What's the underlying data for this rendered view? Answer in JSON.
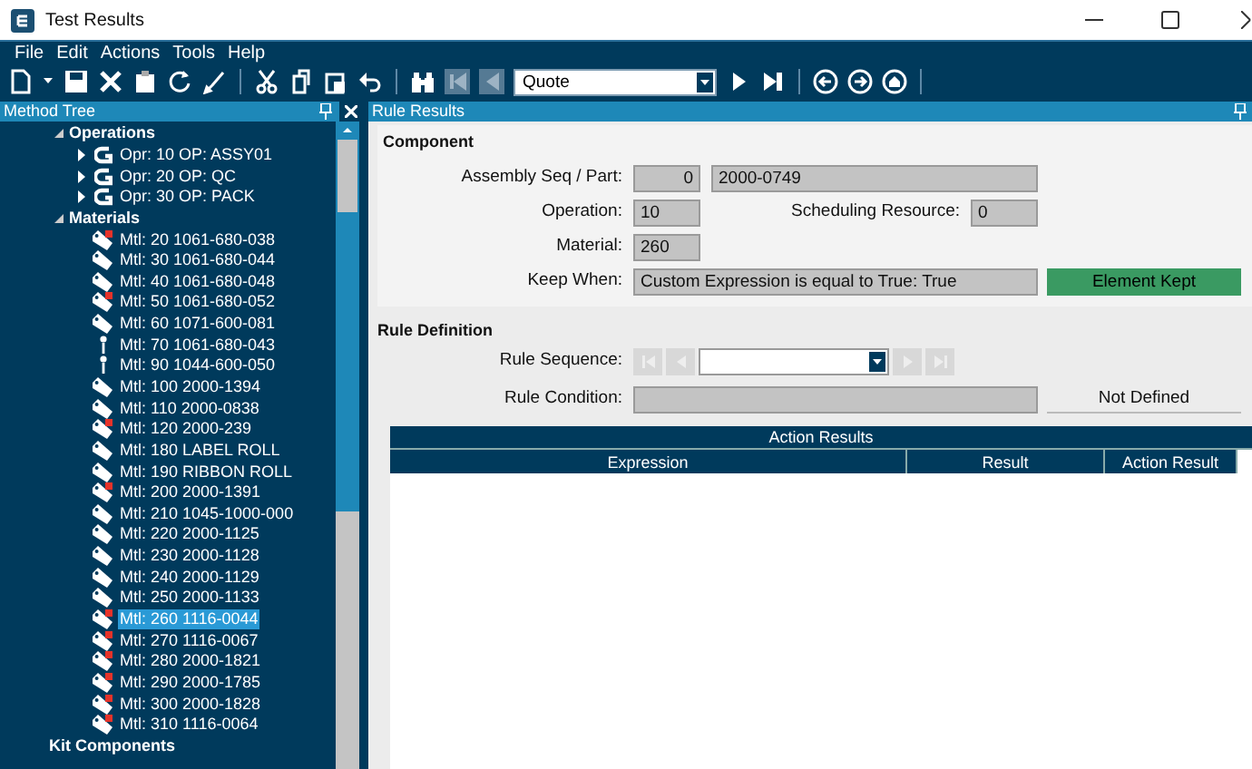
{
  "window": {
    "title": "Test Results"
  },
  "menu": [
    "File",
    "Edit",
    "Actions",
    "Tools",
    "Help"
  ],
  "toolbar": {
    "record_type": {
      "value": "Quote"
    }
  },
  "method_tree": {
    "title": "Method Tree",
    "nodes": [
      {
        "label": "Operations",
        "expanded": true,
        "children": [
          {
            "label": "Opr: 10 OP: ASSY01",
            "kind": "operation",
            "expanded": false,
            "flagged": false,
            "selected": false
          },
          {
            "label": "Opr: 20 OP: QC",
            "kind": "operation",
            "expanded": false,
            "flagged": false,
            "selected": false
          },
          {
            "label": "Opr: 30 OP: PACK",
            "kind": "operation",
            "expanded": false,
            "flagged": false,
            "selected": false
          }
        ]
      },
      {
        "label": "Materials",
        "expanded": true,
        "children": [
          {
            "label": "Mtl: 20 1061-680-038",
            "kind": "tag",
            "flagged": true,
            "selected": false
          },
          {
            "label": "Mtl: 30 1061-680-044",
            "kind": "tag",
            "flagged": false,
            "selected": false
          },
          {
            "label": "Mtl: 40 1061-680-048",
            "kind": "tag",
            "flagged": false,
            "selected": false
          },
          {
            "label": "Mtl: 50 1061-680-052",
            "kind": "tag",
            "flagged": true,
            "selected": false
          },
          {
            "label": "Mtl: 60 1071-600-081",
            "kind": "tag",
            "flagged": false,
            "selected": false
          },
          {
            "label": "Mtl: 70 1061-680-043",
            "kind": "pin",
            "flagged": false,
            "selected": false
          },
          {
            "label": "Mtl: 90 1044-600-050",
            "kind": "pin",
            "flagged": false,
            "selected": false
          },
          {
            "label": "Mtl: 100 2000-1394",
            "kind": "tag",
            "flagged": false,
            "selected": false
          },
          {
            "label": "Mtl: 110 2000-0838",
            "kind": "tag",
            "flagged": false,
            "selected": false
          },
          {
            "label": "Mtl: 120 2000-239",
            "kind": "tag",
            "flagged": true,
            "selected": false
          },
          {
            "label": "Mtl: 180 LABEL ROLL",
            "kind": "tag",
            "flagged": false,
            "selected": false
          },
          {
            "label": "Mtl: 190 RIBBON ROLL",
            "kind": "tag",
            "flagged": false,
            "selected": false
          },
          {
            "label": "Mtl: 200 2000-1391",
            "kind": "tag",
            "flagged": true,
            "selected": false
          },
          {
            "label": "Mtl: 210 1045-1000-000",
            "kind": "tag",
            "flagged": false,
            "selected": false
          },
          {
            "label": "Mtl: 220 2000-1125",
            "kind": "tag",
            "flagged": false,
            "selected": false
          },
          {
            "label": "Mtl: 230 2000-1128",
            "kind": "tag",
            "flagged": false,
            "selected": false
          },
          {
            "label": "Mtl: 240 2000-1129",
            "kind": "tag",
            "flagged": false,
            "selected": false
          },
          {
            "label": "Mtl: 250 2000-1133",
            "kind": "tag",
            "flagged": false,
            "selected": false
          },
          {
            "label": "Mtl: 260 1116-0044",
            "kind": "tag",
            "flagged": true,
            "selected": true
          },
          {
            "label": "Mtl: 270 1116-0067",
            "kind": "tag",
            "flagged": true,
            "selected": false
          },
          {
            "label": "Mtl: 280 2000-1821",
            "kind": "tag",
            "flagged": true,
            "selected": false
          },
          {
            "label": "Mtl: 290 2000-1785",
            "kind": "tag",
            "flagged": true,
            "selected": false
          },
          {
            "label": "Mtl: 300 2000-1828",
            "kind": "tag",
            "flagged": true,
            "selected": false
          },
          {
            "label": "Mtl: 310 1116-0064",
            "kind": "tag",
            "flagged": true,
            "selected": false
          }
        ]
      },
      {
        "label": "Kit Components"
      }
    ]
  },
  "rule_results": {
    "title": "Rule Results",
    "component": {
      "title": "Component",
      "assembly_label": "Assembly Seq / Part:",
      "assembly_seq": "0",
      "part": "2000-0749",
      "operation_label": "Operation:",
      "operation": "10",
      "resource_label": "Scheduling Resource:",
      "scheduling_resource": "0",
      "material_label": "Material:",
      "material": "260",
      "keep_label": "Keep When:",
      "keep_when": "Custom Expression is equal to True: True",
      "outcome": "Element Kept"
    },
    "rule_definition": {
      "title": "Rule Definition",
      "sequence_label": "Rule Sequence:",
      "condition_label": "Rule Condition:",
      "status": "Not Defined"
    },
    "action_results": {
      "title": "Action Results",
      "columns": [
        "Expression",
        "Result",
        "Action Result"
      ]
    }
  }
}
